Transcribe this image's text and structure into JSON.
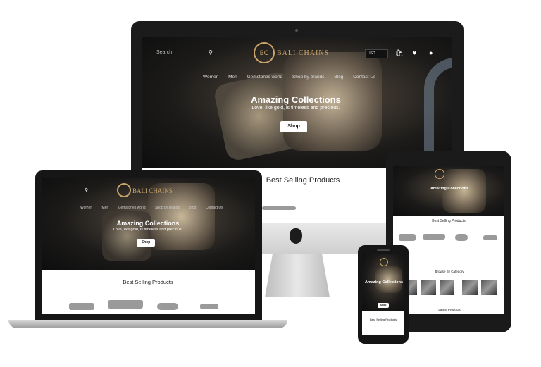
{
  "brand": {
    "name": "BALI CHAINS",
    "monogram": "BC"
  },
  "search": {
    "placeholder": "Search"
  },
  "currency": "USD",
  "cart_count": "0",
  "nav": [
    "Women",
    "Men",
    "Gemstones world",
    "Shop by brands",
    "Blog",
    "Contact Us"
  ],
  "hero": {
    "title": "Amazing Collections",
    "subtitle": "Love, like gold, is timeless and precious.",
    "cta": "Shop"
  },
  "sections": {
    "best_selling": "Best Selling Products",
    "browse_category": "Browse By Category",
    "latest": "Latest Products"
  },
  "colors": {
    "bg": "#ffffff",
    "device_frame": "#1c1c1c",
    "hero_dark": "#1b1a19",
    "gold": "#c8a46a"
  }
}
